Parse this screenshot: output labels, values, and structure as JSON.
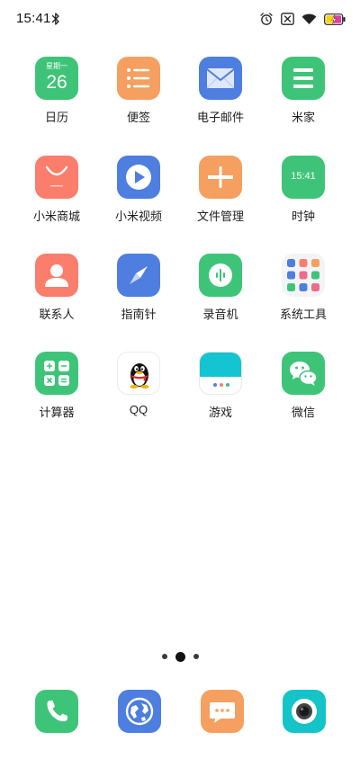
{
  "status_bar": {
    "time": "15:41",
    "icons": [
      "bluetooth-icon",
      "alarm-icon",
      "sim-none-icon",
      "wifi-icon",
      "battery-charging-icon"
    ]
  },
  "apps": [
    {
      "label": "日历",
      "icon": "calendar-icon",
      "weekday": "星期一",
      "day": "26"
    },
    {
      "label": "便签",
      "icon": "notes-icon"
    },
    {
      "label": "电子邮件",
      "icon": "mail-icon"
    },
    {
      "label": "米家",
      "icon": "mijia-icon"
    },
    {
      "label": "小米商城",
      "icon": "mi-store-icon"
    },
    {
      "label": "小米视频",
      "icon": "video-play-icon"
    },
    {
      "label": "文件管理",
      "icon": "file-manager-icon"
    },
    {
      "label": "时钟",
      "icon": "clock-icon",
      "time": "15:41"
    },
    {
      "label": "联系人",
      "icon": "contacts-icon"
    },
    {
      "label": "指南针",
      "icon": "compass-icon"
    },
    {
      "label": "录音机",
      "icon": "recorder-icon"
    },
    {
      "label": "系统工具",
      "icon": "system-tools-folder-icon"
    },
    {
      "label": "计算器",
      "icon": "calculator-icon"
    },
    {
      "label": "QQ",
      "icon": "qq-penguin-icon"
    },
    {
      "label": "游戏",
      "icon": "games-icon"
    },
    {
      "label": "微信",
      "icon": "wechat-icon"
    }
  ],
  "page_indicator": {
    "pages": 3,
    "current": 2
  },
  "dock": [
    {
      "icon": "phone-icon"
    },
    {
      "icon": "browser-icon"
    },
    {
      "icon": "messages-icon"
    },
    {
      "icon": "camera-icon"
    }
  ],
  "colors": {
    "green": "#3ec478",
    "orange": "#f59a5a",
    "blue": "#4d7ee0",
    "coral": "#fb7d6b",
    "teal": "#14c4c8"
  }
}
